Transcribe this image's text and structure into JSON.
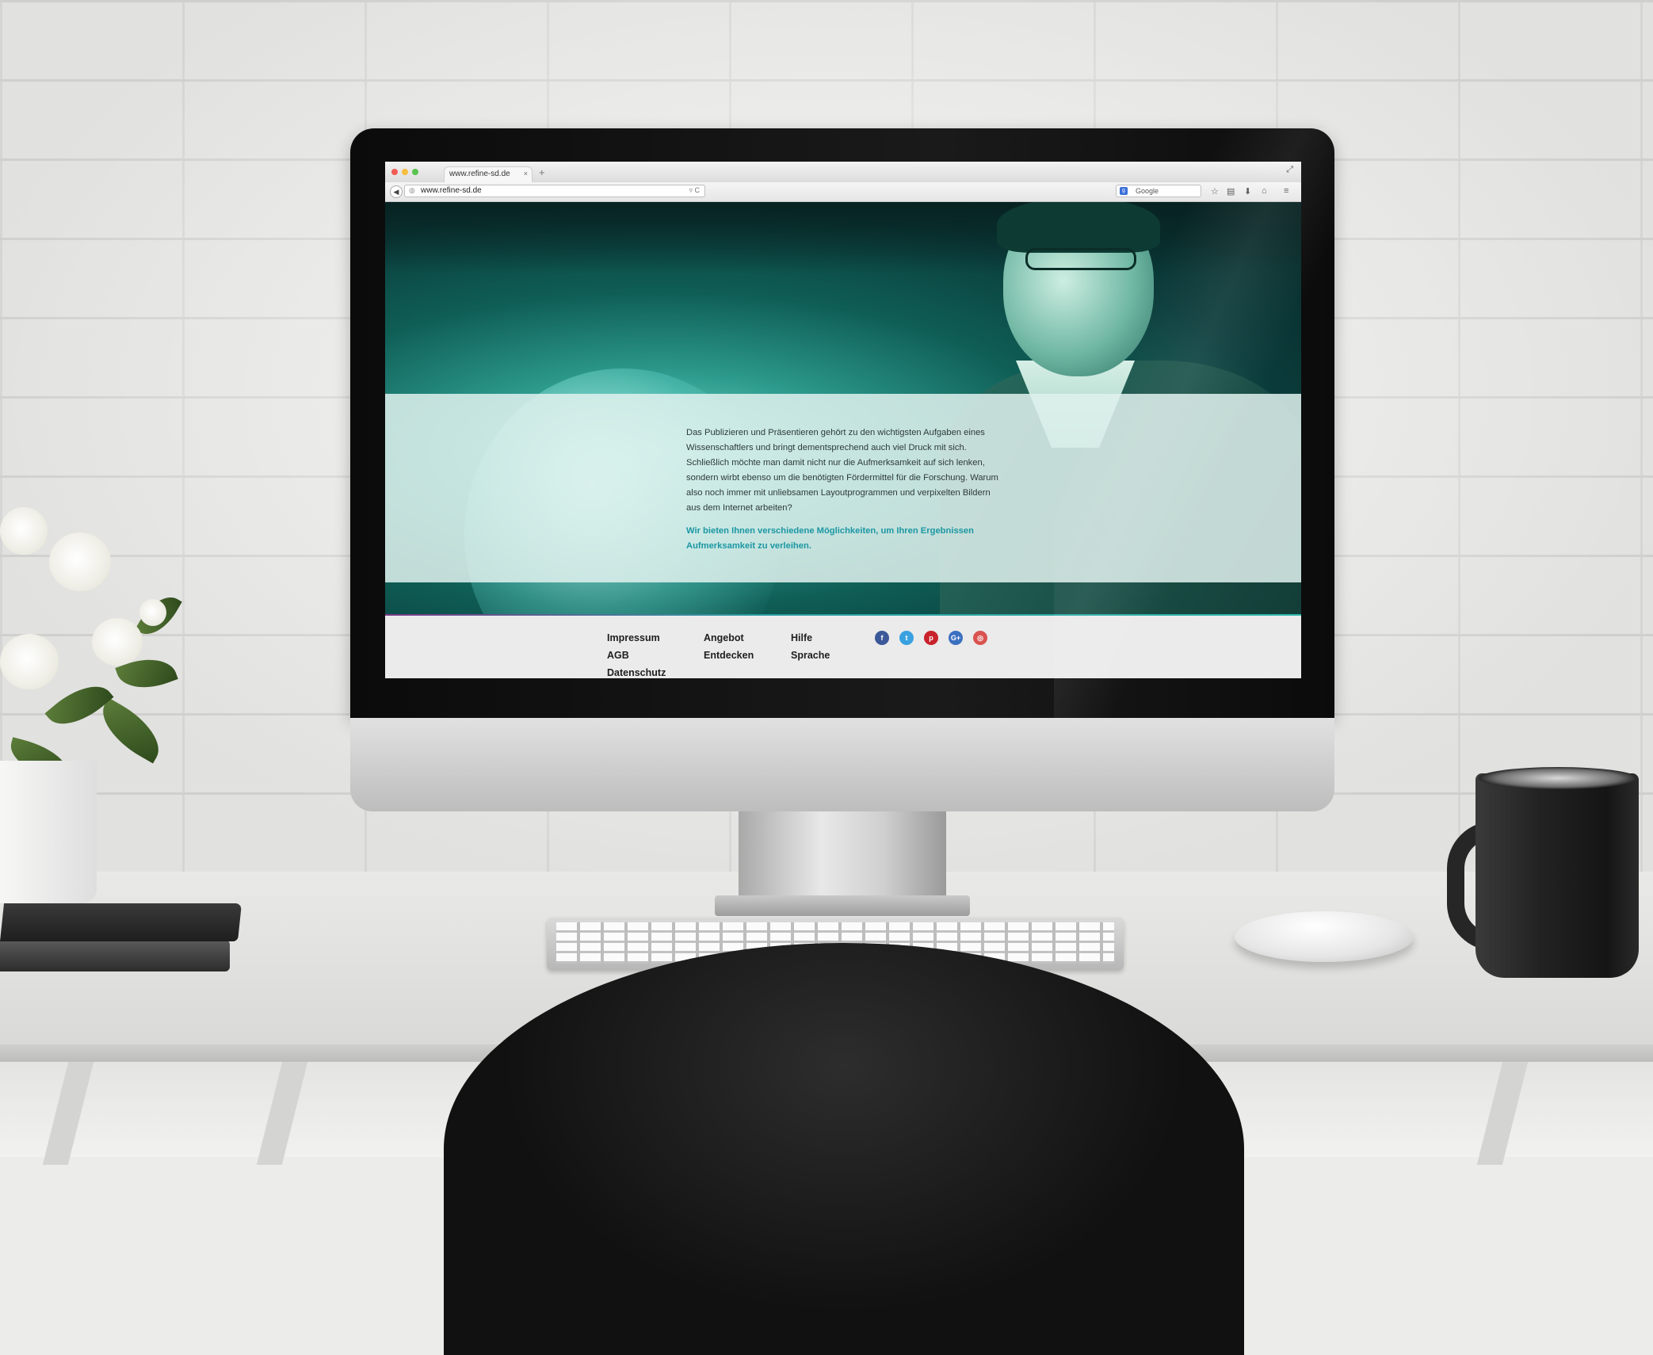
{
  "browser": {
    "tab_title": "www.refine-sd.de",
    "tab_close": "×",
    "new_tab": "+",
    "url": "www.refine-sd.de",
    "url_tools": "▿ C",
    "search_engine_glyph": "g",
    "search_placeholder": "Google",
    "back_glyph": "◀",
    "fullscreen_glyph": "⤢",
    "toolbar_icons": [
      "☆",
      "▤",
      "⬇",
      "⌂",
      "≡"
    ],
    "traffic_lights": [
      "#f25b55",
      "#f5be3f",
      "#56c44d"
    ]
  },
  "page": {
    "hero_text": "Das Publizieren und Präsentieren gehört zu den wichtigsten Aufgaben eines Wissenschaftlers und bringt dementsprechend auch viel Druck mit sich. Schließlich möchte man damit nicht nur die Aufmerksamkeit auf sich lenken, sondern wirbt ebenso um die benötigten Fördermittel für die Forschung. Warum also noch immer mit unliebsamen Layoutprogrammen und verpixelten Bildern aus dem Internet arbeiten?",
    "hero_lead": "Wir bieten Ihnen verschiedene Möglichkeiten, um Ihren Ergebnissen Aufmerksamkeit zu verleihen.",
    "accent_color": "#1b97a3"
  },
  "footer": {
    "col1": [
      "Impressum",
      "AGB",
      "Datenschutz"
    ],
    "col2": [
      "Angebot",
      "Entdecken"
    ],
    "col3": [
      "Hilfe",
      "Sprache"
    ],
    "social": [
      {
        "glyph": "f",
        "color": "#3b5998",
        "icon": "facebook-icon"
      },
      {
        "glyph": "t",
        "color": "#3aa1e0",
        "icon": "twitter-icon"
      },
      {
        "glyph": "p",
        "color": "#c8232c",
        "icon": "pinterest-icon"
      },
      {
        "glyph": "G+",
        "color": "#3b6fc0",
        "icon": "googleplus-icon"
      },
      {
        "glyph": "◎",
        "color": "#d9534f",
        "icon": "instagram-icon"
      }
    ]
  }
}
